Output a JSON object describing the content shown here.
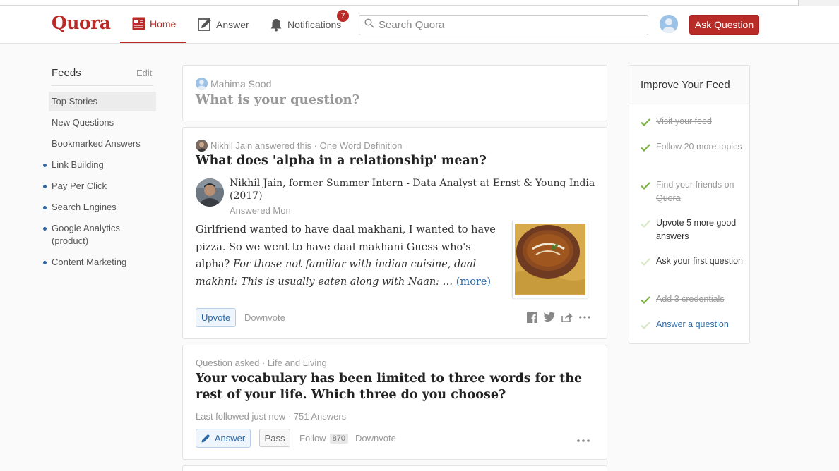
{
  "header": {
    "logo": "Quora",
    "nav": {
      "home": "Home",
      "answer": "Answer",
      "notifications": "Notifications",
      "notifications_count": "7"
    },
    "search_placeholder": "Search Quora",
    "ask_button": "Ask Question"
  },
  "sidebar": {
    "title": "Feeds",
    "edit": "Edit",
    "items": [
      {
        "label": "Top Stories",
        "active": true,
        "dot": false
      },
      {
        "label": "New Questions",
        "dot": false
      },
      {
        "label": "Bookmarked Answers",
        "dot": false
      },
      {
        "label": "Link Building",
        "dot": true
      },
      {
        "label": "Pay Per Click",
        "dot": true
      },
      {
        "label": "Search Engines",
        "dot": true
      },
      {
        "label": "Google Analytics (product)",
        "dot": true
      },
      {
        "label": "Content Marketing",
        "dot": true
      }
    ]
  },
  "ask_box": {
    "user": "Mahima Sood",
    "prompt": "What is your question?"
  },
  "answer_card": {
    "meta": "Nikhil Jain answered this · One Word Definition",
    "question": "What does 'alpha in a relationship' mean?",
    "author_credential": "Nikhil Jain, former Summer Intern - Data Analyst at Ernst & Young India (2017)",
    "answered": "Answered Mon",
    "text_plain": "Girlfriend wanted to have daal makhani, I wanted to have pizza. So we went to have daal makhani Guess who's alpha? ",
    "text_italic": "For those not familiar with indian cuisine, daal makhni: This is usually eaten along with Naan: … ",
    "more": "(more)",
    "upvote": "Upvote",
    "downvote": "Downvote",
    "share_icons": [
      "facebook-icon",
      "twitter-icon",
      "share-icon",
      "more-icon"
    ]
  },
  "question_card": {
    "meta": "Question asked · Life and Living",
    "question": "Your vocabulary has been limited to three words for the rest of your life. Which three do you choose?",
    "stats": "Last followed just now · 751 Answers",
    "answer": "Answer",
    "pass": "Pass",
    "follow": "Follow",
    "follow_count": "870",
    "downvote": "Downvote"
  },
  "improve_feed": {
    "title": "Improve Your Feed",
    "tasks": [
      {
        "label": "Visit your feed",
        "done": true
      },
      {
        "label": "Follow 20 more topics",
        "done": true
      },
      {
        "label": "Find your friends on Quora",
        "done": true
      },
      {
        "label": "Upvote 5 more good answers",
        "done": false
      },
      {
        "label": "Ask your first question",
        "done": false
      },
      {
        "label": "Add 3 credentials",
        "done": true
      },
      {
        "label": "Answer a question",
        "done": false,
        "link": true
      }
    ]
  },
  "colors": {
    "brand": "#b92b27",
    "link": "#2e69a3",
    "check_done": "#7cb342",
    "check_todo": "#d6e8c4"
  }
}
